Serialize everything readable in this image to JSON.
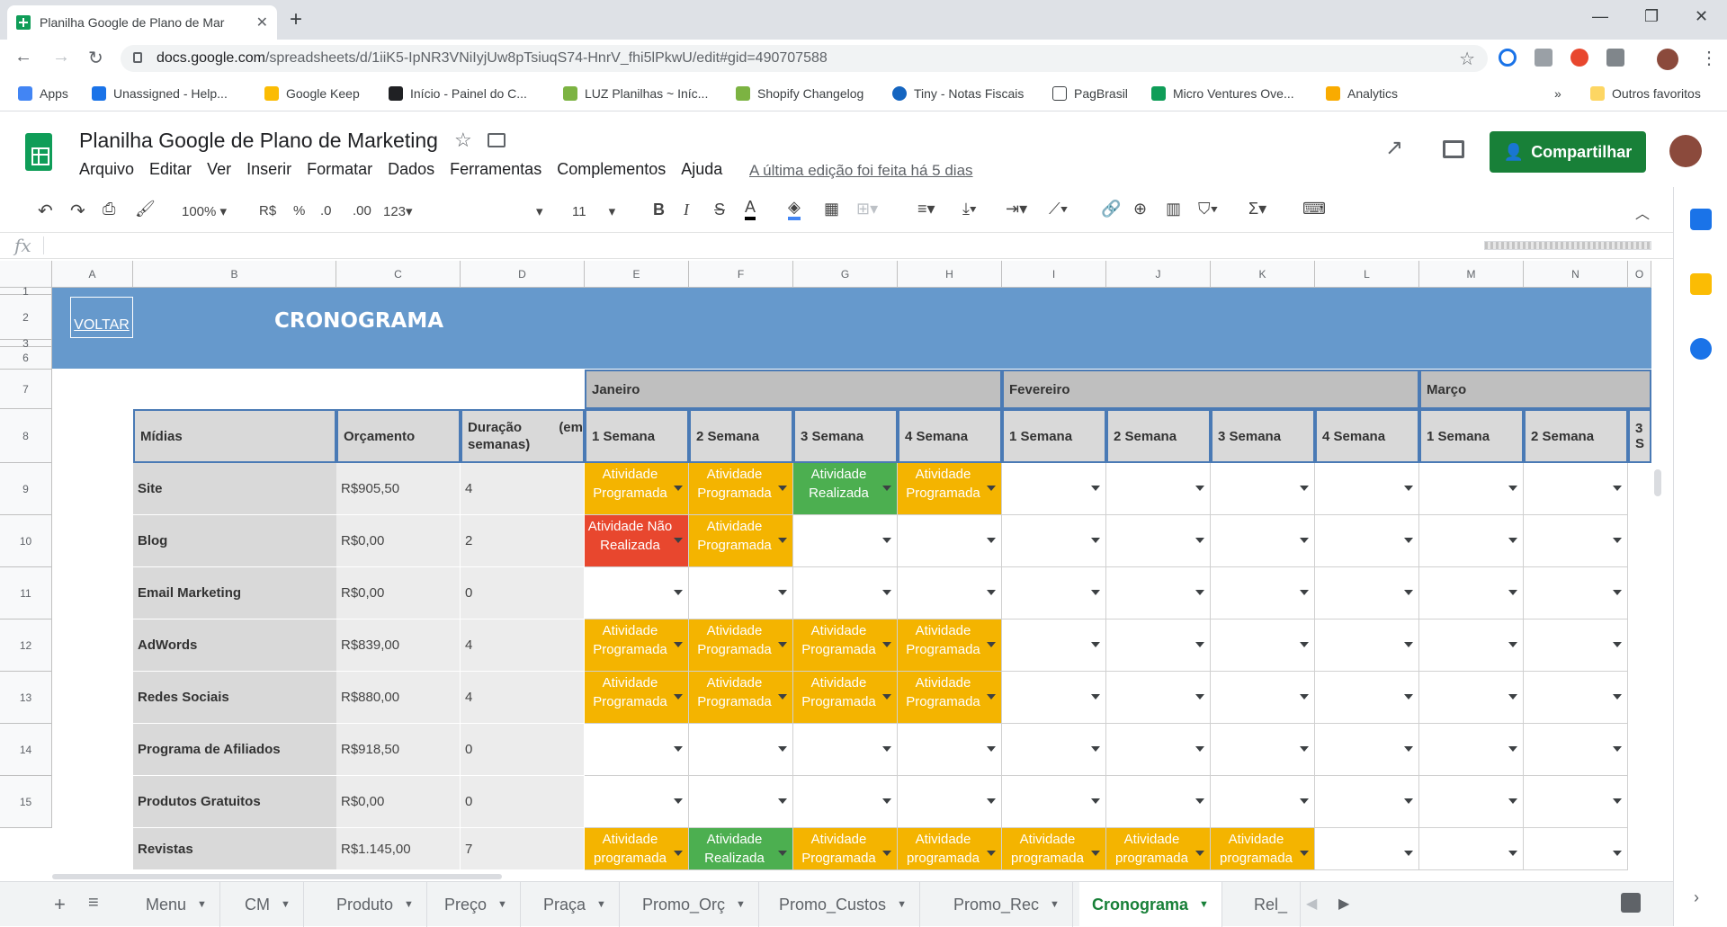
{
  "browser": {
    "tab_title": "Planilha Google de Plano de Mar",
    "url_host": "docs.google.com",
    "url_path": "/spreadsheets/d/1iiK5-IpNR3VNiIyjUw8pTsiuqS74-HnrV_fhi5lPkwU/edit#gid=490707588",
    "bookmarks": [
      "Apps",
      "Unassigned - Help...",
      "Google Keep",
      "Início - Painel do C...",
      "LUZ Planilhas ~ Iníc...",
      "Shopify Changelog",
      "Tiny - Notas Fiscais",
      "PagBrasil",
      "Micro Ventures Ove...",
      "Analytics"
    ],
    "bookmarks_more": "»",
    "other_bookmarks": "Outros favoritos"
  },
  "app": {
    "doc_title": "Planilha Google de Plano de Marketing",
    "menu": [
      "Arquivo",
      "Editar",
      "Ver",
      "Inserir",
      "Formatar",
      "Dados",
      "Ferramentas",
      "Complementos",
      "Ajuda"
    ],
    "last_edit": "A última edição foi feita há 5 dias",
    "share_label": "Compartilhar"
  },
  "toolbar": {
    "zoom": "100%",
    "currency": "R$",
    "percent": "%",
    "dec_less": ".0",
    "dec_more": ".00",
    "format_more": "123",
    "font_size": "11",
    "fx": "fx"
  },
  "columns": [
    "A",
    "B",
    "C",
    "D",
    "E",
    "F",
    "G",
    "H",
    "I",
    "J",
    "K",
    "L",
    "M",
    "N",
    "O"
  ],
  "rows": [
    "1",
    "2",
    "3",
    "6",
    "7",
    "8",
    "9",
    "10",
    "11",
    "12",
    "13",
    "14",
    "15"
  ],
  "sheet": {
    "voltar": "VOLTAR",
    "title": "CRONOGRAMA",
    "months": [
      "Janeiro",
      "Fevereiro",
      "Março"
    ],
    "headers": {
      "midias": "Mídias",
      "orcamento": "Orçamento",
      "duracao_a": "Duração",
      "duracao_b": "(em",
      "duracao_c": "semanas)",
      "weeks": [
        "1 Semana",
        "2 Semana",
        "3 Semana",
        "4 Semana",
        "1 Semana",
        "2 Semana",
        "3 Semana",
        "4 Semana",
        "1 Semana",
        "2 Semana",
        "3 S"
      ]
    },
    "data_rows": [
      {
        "midia": "Site",
        "orcamento": "R$905,50",
        "duracao": "4",
        "weeks": [
          "P",
          "P",
          "R",
          "P",
          "",
          "",
          "",
          "",
          "",
          ""
        ]
      },
      {
        "midia": "Blog",
        "orcamento": "R$0,00",
        "duracao": "2",
        "weeks": [
          "N",
          "P",
          "",
          "",
          "",
          "",
          "",
          "",
          "",
          ""
        ]
      },
      {
        "midia": "Email Marketing",
        "orcamento": "R$0,00",
        "duracao": "0",
        "weeks": [
          "",
          "",
          "",
          "",
          "",
          "",
          "",
          "",
          "",
          ""
        ]
      },
      {
        "midia": "AdWords",
        "orcamento": "R$839,00",
        "duracao": "4",
        "weeks": [
          "P",
          "P",
          "P",
          "P",
          "",
          "",
          "",
          "",
          "",
          ""
        ]
      },
      {
        "midia": "Redes Sociais",
        "orcamento": "R$880,00",
        "duracao": "4",
        "weeks": [
          "P",
          "P",
          "P",
          "P",
          "",
          "",
          "",
          "",
          "",
          ""
        ]
      },
      {
        "midia": "Programa de Afiliados",
        "orcamento": "R$918,50",
        "duracao": "0",
        "weeks": [
          "",
          "",
          "",
          "",
          "",
          "",
          "",
          "",
          "",
          ""
        ]
      },
      {
        "midia": "Produtos Gratuitos",
        "orcamento": "R$0,00",
        "duracao": "0",
        "weeks": [
          "",
          "",
          "",
          "",
          "",
          "",
          "",
          "",
          "",
          ""
        ]
      },
      {
        "midia": "Revistas",
        "orcamento": "R$1.145,00",
        "duracao": "7",
        "weeks": [
          "p",
          "R",
          "P",
          "p",
          "p",
          "p",
          "p",
          "",
          "",
          ""
        ]
      }
    ],
    "status_labels": {
      "P": "Atividade Programada",
      "p": "Atividade programada",
      "R": "Atividade Realizada",
      "N": "Atividade Não Realizada"
    },
    "status_colors": {
      "P": "#f4b400",
      "p": "#f4b400",
      "R": "#4caf50",
      "N": "#e8472e"
    }
  },
  "tabs": [
    "Menu",
    "CM",
    "Produto",
    "Preço",
    "Praça",
    "Promo_Orç",
    "Promo_Custos",
    "Promo_Rec",
    "Cronograma",
    "Rel_"
  ],
  "active_tab": "Cronograma"
}
